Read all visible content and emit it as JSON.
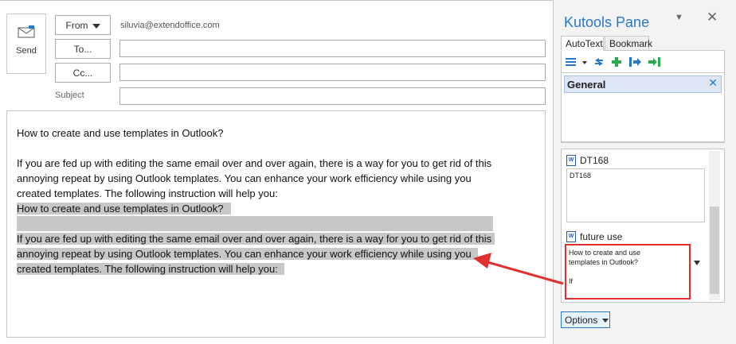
{
  "compose": {
    "send_label": "Send",
    "from_label": "From",
    "from_email": "siluvia@extendoffice.com",
    "to_label": "To...",
    "cc_label": "Cc...",
    "subject_label": "Subject",
    "to_value": "",
    "cc_value": "",
    "subject_value": "",
    "body": {
      "title": "How to create and use templates in Outlook?",
      "para_lines": [
        "If you are fed up with editing the same email over and over again, there is a way for you to get rid of this",
        "annoying repeat by using Outlook templates. You can enhance your work efficiency while using you",
        "created templates. The following instruction will help you:"
      ],
      "pasted_title": "How to create and use templates in Outlook?",
      "pasted_lines": [
        "If you are fed up with editing the same email over and over again, there is a way for you to get rid of this",
        "annoying repeat by using Outlook templates. You can enhance your work efficiency while using you",
        "created templates. The following instruction will help you:"
      ]
    }
  },
  "pane": {
    "title": "Kutools Pane",
    "tabs": [
      "AutoText",
      "Bookmark"
    ],
    "active_tab": "AutoText",
    "toolbar_icons": [
      "list-icon",
      "dropdown-icon",
      "sync-icon",
      "add-icon",
      "insert-icon",
      "insert-end-icon"
    ],
    "group": {
      "name": "General"
    },
    "items": [
      {
        "name": "DT168",
        "preview": "DT168"
      },
      {
        "name": "future use",
        "preview_lines": [
          "How to create and use",
          "templates in Outlook?",
          "",
          "If"
        ]
      }
    ],
    "options_label": "Options"
  },
  "colors": {
    "accent": "#2b78c2",
    "highlight": "#c8c8c8",
    "callout": "#e03030"
  }
}
